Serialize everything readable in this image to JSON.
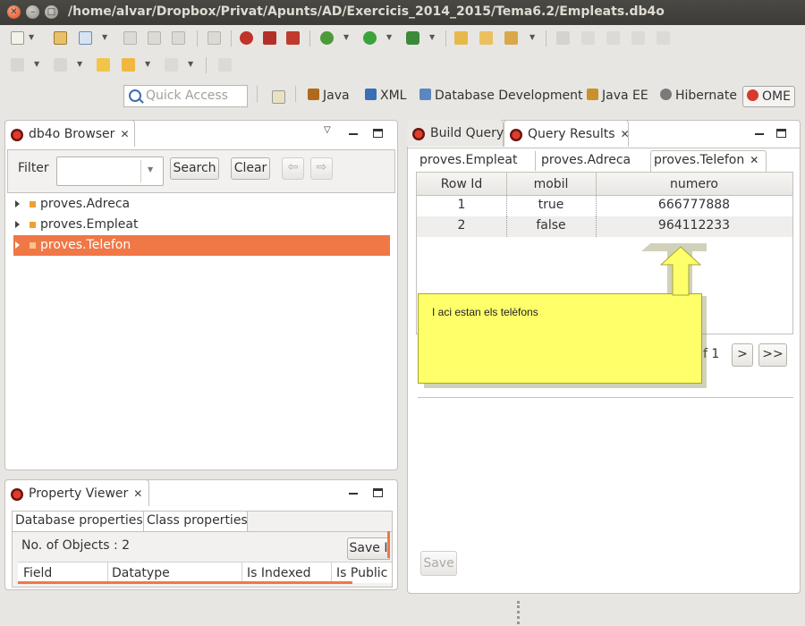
{
  "window": {
    "title": "/home/alvar/Dropbox/Privat/Apunts/AD/Exercicis_2014_2015/Tema6.2/Empleats.db4o",
    "close_glyph": "✕",
    "minimize_glyph": "–",
    "maximize_glyph": "□"
  },
  "toolbar": {
    "icons": [
      "new-icon",
      "new-project-icon",
      "new-class-icon",
      "save-icon",
      "save-all-icon",
      "print-icon",
      "skip-icon",
      "db4o-connect-icon",
      "db4o-query-icon",
      "db4o-object-icon",
      "debug-icon",
      "run-icon",
      "run-external-icon",
      "open-type-icon",
      "open-folder-icon",
      "wand-icon",
      "search-icon",
      "pin-icon",
      "bolt-icon",
      "bookmark-icon",
      "paragraph-icon"
    ],
    "row2_icons": [
      "next-annotation-icon",
      "prev-annotation-icon",
      "last-edit-icon",
      "back-icon",
      "forward-icon",
      "pin-editor-icon"
    ]
  },
  "quick_access": {
    "placeholder": "Quick Access"
  },
  "perspectives": [
    {
      "label": "Java",
      "icon": "java-perspective-icon",
      "color": "#b06a1e"
    },
    {
      "label": "XML",
      "icon": "xml-perspective-icon",
      "color": "#3a6fb5"
    },
    {
      "label": "Database Development",
      "icon": "database-icon",
      "color": "#5c86bf"
    },
    {
      "label": "Java EE",
      "icon": "javaee-icon",
      "color": "#c7912c"
    },
    {
      "label": "Hibernate",
      "icon": "hibernate-icon",
      "color": "#7a7a7a"
    },
    {
      "label": "OME",
      "icon": "ome-icon",
      "color": "#d63b2b",
      "active": true
    }
  ],
  "db4o_browser": {
    "tab_label": "db4o Browser",
    "filter_label": "Filter",
    "search_label": "Search",
    "clear_label": "Clear",
    "back_glyph": "⇦",
    "forward_glyph": "⇨",
    "items": [
      {
        "label": "proves.Adreca",
        "selected": false
      },
      {
        "label": "proves.Empleat",
        "selected": false
      },
      {
        "label": "proves.Telefon",
        "selected": true
      }
    ]
  },
  "property_viewer": {
    "tab_label": "Property Viewer",
    "tabs": [
      "Database properties",
      "Class properties"
    ],
    "objects_label": "No. of Objects : 2",
    "save_label": "Save I",
    "columns": [
      "Field",
      "Datatype",
      "Is Indexed",
      "Is Public"
    ]
  },
  "query_panel": {
    "tabs": [
      "Build Query",
      "Query Results"
    ],
    "result_tabs": [
      "proves.Empleat",
      "proves.Adreca",
      "proves.Telefon"
    ],
    "columns": [
      "Row Id",
      "mobil",
      "numero"
    ],
    "rows": [
      [
        "1",
        "true",
        "666777888"
      ],
      [
        "2",
        "false",
        "964112233"
      ]
    ],
    "page_text": "f 1",
    "next_label": ">",
    "last_label": ">>",
    "save_label": "Save"
  },
  "callout": {
    "text": "I aci estan els telèfons"
  },
  "colors": {
    "accent": "#f07746",
    "callout_fill": "#ffff66",
    "titlebar": "#3c3b37"
  }
}
